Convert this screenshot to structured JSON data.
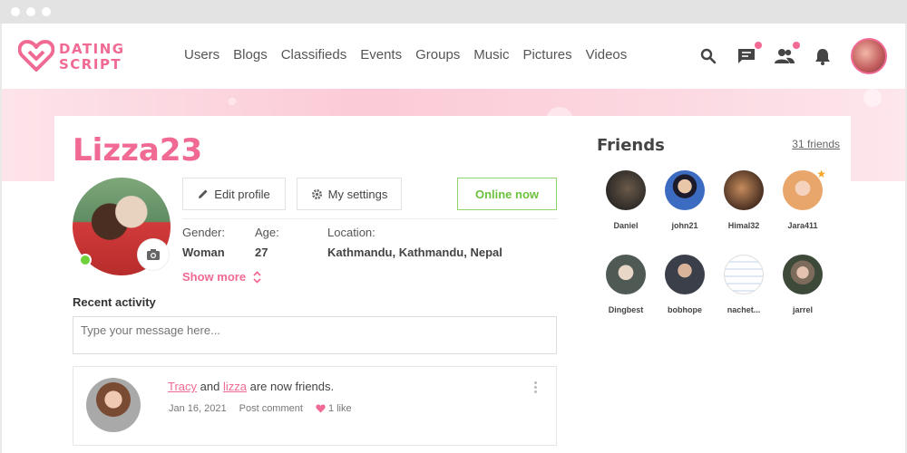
{
  "brand": {
    "line1": "DATING",
    "line2": "SCRIPT",
    "color": "#f06a93"
  },
  "nav": [
    "Users",
    "Blogs",
    "Classifieds",
    "Events",
    "Groups",
    "Music",
    "Pictures",
    "Videos"
  ],
  "header_icons": [
    "search-icon",
    "chat-icon",
    "friends-icon",
    "bell-icon"
  ],
  "profile": {
    "username": "Lizza23",
    "status": "online",
    "buttons": {
      "edit": "Edit profile",
      "settings": "My settings",
      "online": "Online now"
    },
    "info": {
      "gender_label": "Gender:",
      "gender": "Woman",
      "age_label": "Age:",
      "age": "27",
      "location_label": "Location:",
      "location": "Kathmandu, Kathmandu, Nepal"
    },
    "show_more": "Show more"
  },
  "activity": {
    "title": "Recent activity",
    "input_placeholder": "Type your message here...",
    "items": [
      {
        "user1": "Tracy",
        "connector": "and",
        "user2": "lizza",
        "suffix": "are now friends.",
        "date": "Jan 16, 2021",
        "comment": "Post comment",
        "likes": "1 like"
      }
    ]
  },
  "friends": {
    "title": "Friends",
    "count": "31 friends",
    "list": [
      {
        "name": "Daniel"
      },
      {
        "name": "john21"
      },
      {
        "name": "Himal32"
      },
      {
        "name": "Jara411",
        "featured": true
      },
      {
        "name": "Dingbest"
      },
      {
        "name": "bobhope"
      },
      {
        "name": "nachet..."
      },
      {
        "name": "jarrel"
      }
    ]
  }
}
